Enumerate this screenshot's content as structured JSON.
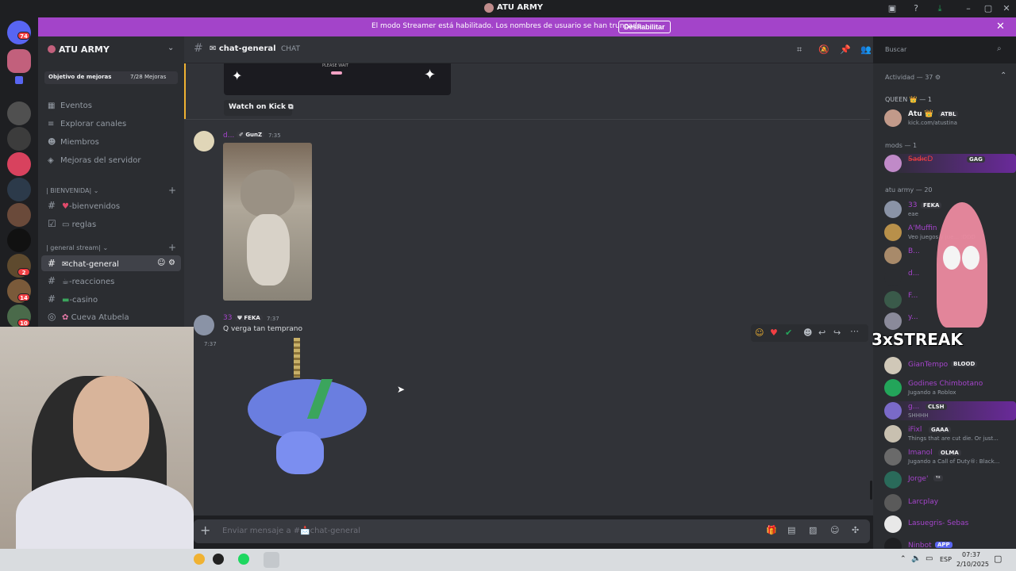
{
  "app": {
    "window_title": "ATU ARMY"
  },
  "banner": {
    "message": "El modo Streamer está habilitado. Los nombres de usuario se han truncado.",
    "button": "Deshabilitar"
  },
  "guild_badges": [
    "74",
    "2",
    "14",
    "10"
  ],
  "server": {
    "name": "ATU ARMY",
    "boost_label": "Objetivo de mejoras",
    "boost_count": "7/28 Mejoras"
  },
  "nav": [
    "Eventos",
    "Explorar canales",
    "Miembros",
    "Mejoras del servidor"
  ],
  "categories": [
    {
      "name": "| BIENVENIDA|",
      "channels": [
        "-bienvenidos",
        "reglas"
      ]
    },
    {
      "name": "| general stream|",
      "channels": [
        "chat-general",
        "-reacciones",
        "-casino",
        "Cueva Atubela"
      ]
    }
  ],
  "channel": {
    "name": "chat-general",
    "type": "CHAT"
  },
  "search": {
    "placeholder": "Buscar"
  },
  "messages": [
    {
      "embed_watch": "Watch on Kick",
      "embed_text": "PLEASE WAIT"
    },
    {
      "author": "d...",
      "tag": "GunZ",
      "time": "7:35"
    },
    {
      "author": "33",
      "tag": "FEKA",
      "time": "7:37",
      "text": "Q verga tan temprano"
    },
    {
      "time": "7:37"
    }
  ],
  "composer": {
    "placeholder": "Enviar mensaje a #📩chat-general"
  },
  "members": {
    "activity": "Actividad — 37",
    "sections": [
      {
        "header": "QUEEN 👑 — 1",
        "members": [
          {
            "name": "Atu 👑",
            "tag": "ATBL",
            "status": "kick.com/atustina",
            "color": "#f2f3f5"
          }
        ]
      },
      {
        "header": "mods — 1",
        "members": [
          {
            "name": "S̶a̶̶d̶̶ı̶̶c̶D",
            "tag": "GAG",
            "status": "",
            "color": "#f23f43"
          }
        ]
      },
      {
        "header": "atu army — 20",
        "members": [
          {
            "name": "33",
            "tag": "FEKA",
            "status": "eae",
            "color": "#a544cc"
          },
          {
            "name": "A'Muffin",
            "tag": "",
            "status": "Veo juegos y jue... :DDD",
            "color": "#a544cc"
          },
          {
            "name": "B...",
            "tag": "",
            "status": "",
            "color": "#a544cc"
          },
          {
            "name": "d...",
            "tag": "",
            "status": "",
            "color": "#a544cc"
          },
          {
            "name": "F...",
            "tag": "",
            "status": "",
            "color": "#a544cc"
          },
          {
            "name": "y...",
            "tag": "",
            "status": "",
            "color": "#a544cc"
          },
          {
            "name": "GianTempo",
            "tag": "BLOOD",
            "status": "",
            "color": "#a544cc"
          },
          {
            "name": "Godines Chimbotano",
            "tag": "",
            "status": "Jugando a Roblox",
            "color": "#a544cc"
          },
          {
            "name": "g...",
            "tag": "CLSH",
            "status": "SHHHH",
            "color": "#a544cc"
          },
          {
            "name": "iFixl",
            "tag": "GAAA",
            "status": "Things that are cut die. Or just...",
            "color": "#a544cc"
          },
          {
            "name": "Imanol",
            "tag": "OLMA",
            "status": "Jugando a Call of Duty®: Black...",
            "color": "#a544cc"
          },
          {
            "name": "Jorge'",
            "tag": "ᵗᶻ",
            "status": "",
            "color": "#a544cc"
          },
          {
            "name": "Larcplay",
            "tag": "",
            "status": "",
            "color": "#a544cc"
          },
          {
            "name": "Lasuegris- Sebas",
            "tag": "",
            "status": "",
            "color": "#a544cc"
          },
          {
            "name": "Ninbot",
            "tag": "APP",
            "status": "",
            "color": "#a544cc"
          }
        ]
      }
    ]
  },
  "overlay": {
    "streak": "3xSTREAK"
  },
  "taskbar": {
    "lang": "ESP",
    "time": "07:37",
    "date": "2/10/2025"
  },
  "colors": {
    "accent": "#a344c9",
    "mod": "#f23f43",
    "member": "#a544cc"
  }
}
